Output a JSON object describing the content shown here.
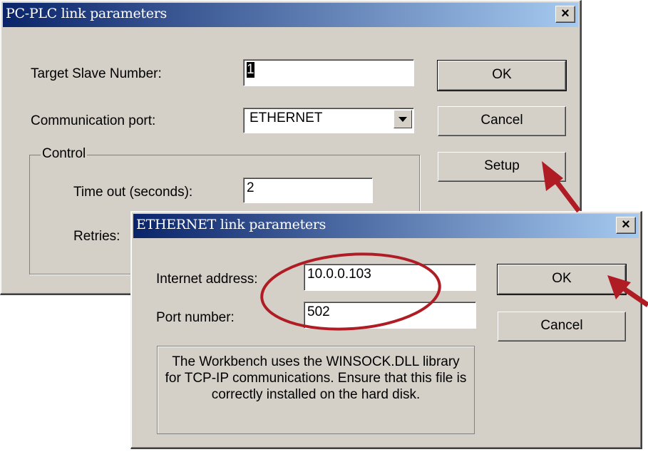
{
  "pc_plc_dialog": {
    "title": "PC-PLC link parameters",
    "close_glyph": "×",
    "target_slave_label": "Target Slave Number:",
    "target_slave_value": "1",
    "comm_port_label": "Communication port:",
    "comm_port_value": "ETHERNET",
    "control_group_title": "Control",
    "timeout_label": "Time out (seconds):",
    "timeout_value": "2",
    "retries_label": "Retries:",
    "ok_label": "OK",
    "cancel_label": "Cancel",
    "setup_label": "Setup"
  },
  "ethernet_dialog": {
    "title": "ETHERNET link parameters",
    "close_glyph": "×",
    "internet_address_label": "Internet address:",
    "internet_address_value": "10.0.0.103",
    "port_number_label": "Port number:",
    "port_number_value": "502",
    "ok_label": "OK",
    "cancel_label": "Cancel",
    "note_text": "The Workbench uses the WINSOCK.DLL library for TCP-IP communications. Ensure that this file is correctly installed on the hard disk."
  },
  "annotations": {
    "arrow_color": "#b01c24",
    "ellipse_color": "#b01c24"
  }
}
